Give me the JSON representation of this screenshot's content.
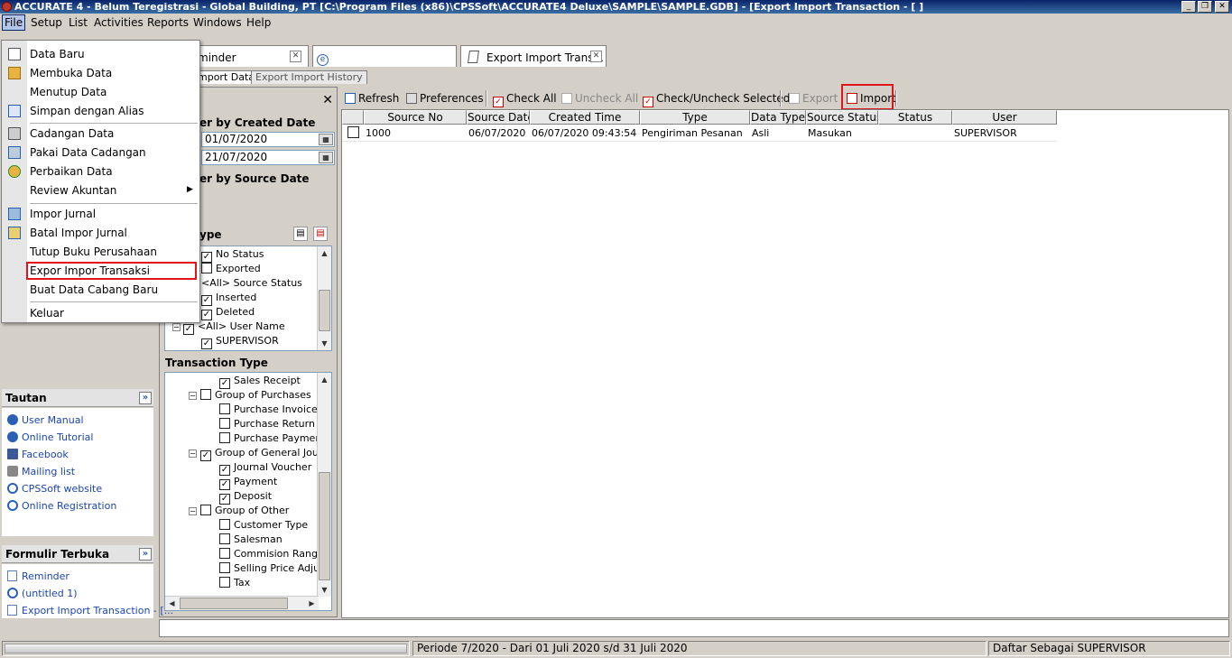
{
  "window": {
    "title": "ACCURATE 4  - Belum Teregistrasi - Global Building, PT   [C:\\Program Files (x86)\\CPSSoft\\ACCURATE4 Deluxe\\SAMPLE\\SAMPLE.GDB] - [Export Import Transaction - [ ]"
  },
  "menubar": [
    "File",
    "Setup",
    "List",
    "Activities",
    "Reports",
    "Windows",
    "Help"
  ],
  "doc_tabs": [
    "minder",
    "Export Import Trans..."
  ],
  "sub_tabs": [
    "mport Data",
    "Export Import History"
  ],
  "file_menu": {
    "items": [
      {
        "label": "Data Baru",
        "icon": "new-file-icon"
      },
      {
        "label": "Membuka Data",
        "icon": "open-folder-icon"
      },
      {
        "label": "Menutup Data",
        "icon": ""
      },
      {
        "label": "Simpan dengan Alias",
        "icon": "save-alias-icon"
      },
      {
        "label": "Cadangan Data",
        "icon": "backup-icon"
      },
      {
        "label": "Pakai Data Cadangan",
        "icon": "restore-icon"
      },
      {
        "label": "Perbaikan Data",
        "icon": "repair-icon"
      },
      {
        "label": "Review Akuntan",
        "icon": ""
      },
      {
        "label": "Impor Jurnal",
        "icon": "import-journal-icon"
      },
      {
        "label": "Batal Impor Jurnal",
        "icon": "cancel-import-icon"
      },
      {
        "label": "Tutup Buku Perusahaan",
        "icon": ""
      },
      {
        "label": "Expor Impor Transaksi",
        "icon": ""
      },
      {
        "label": "Buat Data Cabang Baru",
        "icon": ""
      },
      {
        "label": "Keluar",
        "icon": ""
      }
    ],
    "highlighted": "Expor Impor Transaksi"
  },
  "filter": {
    "created_date_label": "er by Created Date",
    "date_from": "01/07/2020",
    "date_to": "21/07/2020",
    "source_date_label": "er by Source Date",
    "type_label": "ype",
    "status_tree": [
      {
        "label": "No Status",
        "checked": true
      },
      {
        "label": "Exported",
        "checked": false
      },
      {
        "label": "<All> Source Status",
        "checked": null
      },
      {
        "label": "Inserted",
        "checked": true
      },
      {
        "label": "Deleted",
        "checked": true
      },
      {
        "label": "<All> User Name",
        "checked": true
      },
      {
        "label": "SUPERVISOR",
        "checked": true
      }
    ],
    "transaction_type_label": "Transaction Type",
    "transaction_tree": [
      {
        "label": "Sales Receipt",
        "checked": true,
        "level": 2
      },
      {
        "label": "Group of Purchases",
        "checked": false,
        "level": 1
      },
      {
        "label": "Purchase Invoice",
        "checked": false,
        "level": 2
      },
      {
        "label": "Purchase Return",
        "checked": false,
        "level": 2
      },
      {
        "label": "Purchase Payment",
        "checked": false,
        "level": 2
      },
      {
        "label": "Group of General Journa",
        "checked": true,
        "level": 1
      },
      {
        "label": "Journal Voucher",
        "checked": true,
        "level": 2
      },
      {
        "label": "Payment",
        "checked": true,
        "level": 2
      },
      {
        "label": "Deposit",
        "checked": true,
        "level": 2
      },
      {
        "label": "Group of Other",
        "checked": false,
        "level": 1
      },
      {
        "label": "Customer Type",
        "checked": false,
        "level": 2
      },
      {
        "label": "Salesman",
        "checked": false,
        "level": 2
      },
      {
        "label": "Commision Range",
        "checked": false,
        "level": 2
      },
      {
        "label": "Selling Price Adjustr",
        "checked": false,
        "level": 2
      },
      {
        "label": "Tax",
        "checked": false,
        "level": 2
      }
    ]
  },
  "toolbar": {
    "refresh": "Refresh",
    "preferences": "Preferences",
    "check_all": "Check All",
    "uncheck_all": "Uncheck All",
    "check_uncheck_selected": "Check/Uncheck Selected",
    "export": "Export",
    "import": "Import"
  },
  "grid": {
    "columns": [
      "Source No",
      "Source Date",
      "Created Time",
      "Type",
      "Data Type",
      "Source Status",
      "Status",
      "User"
    ],
    "rows": [
      {
        "source_no": "1000",
        "source_date": "06/07/2020",
        "created_time": "06/07/2020 09:43:54",
        "type": "Pengiriman Pesanan",
        "data_type": "Asli",
        "source_status": "Masukan",
        "status": "",
        "user": "SUPERVISOR",
        "checked": false
      }
    ]
  },
  "sidebar": {
    "tautan_title": "Tautan",
    "links": [
      "User Manual",
      "Online Tutorial",
      "Facebook",
      "Mailing list",
      "CPSSoft website",
      "Online Registration"
    ],
    "formulir_title": "Formulir Terbuka",
    "open_forms": [
      "Reminder",
      "(untitled 1)",
      "Export Import Transaction - [..."
    ]
  },
  "statusbar": {
    "periode": "Periode 7/2020 - Dari 01 Juli 2020 s/d 31 Juli 2020",
    "user": "Daftar Sebagai SUPERVISOR"
  },
  "colors": {
    "highlight": "#e0151b",
    "title_bar": "#0a246a",
    "link": "#1c45b0"
  }
}
